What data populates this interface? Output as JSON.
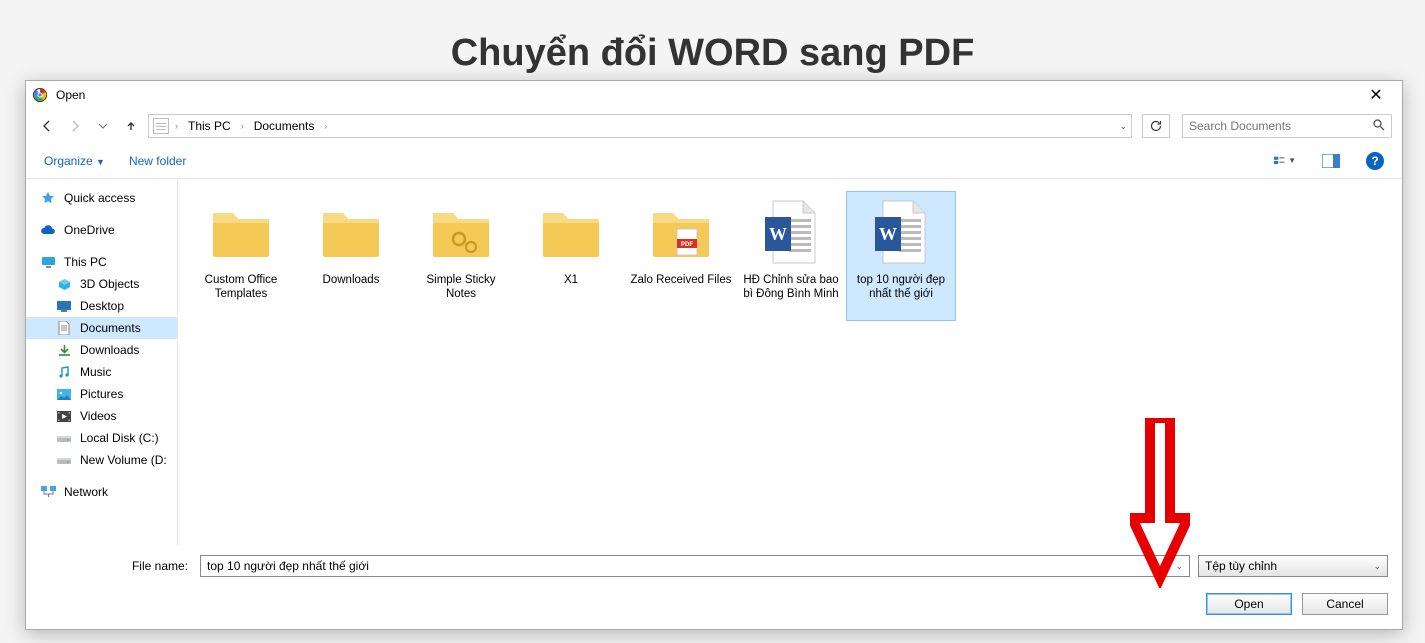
{
  "page": {
    "heading": "Chuyển đổi WORD sang PDF"
  },
  "dialog": {
    "title": "Open",
    "breadcrumb": {
      "root_sep": "›",
      "parts": [
        "This PC",
        "Documents"
      ]
    },
    "search_placeholder": "Search Documents",
    "toolbar": {
      "organize": "Organize",
      "new_folder": "New folder"
    },
    "sidebar": {
      "quick_access": "Quick access",
      "onedrive": "OneDrive",
      "this_pc": "This PC",
      "items": [
        "3D Objects",
        "Desktop",
        "Documents",
        "Downloads",
        "Music",
        "Pictures",
        "Videos",
        "Local Disk (C:)",
        "New Volume (D:"
      ],
      "network": "Network"
    },
    "files": [
      {
        "name": "Custom Office Templates",
        "type": "folder"
      },
      {
        "name": "Downloads",
        "type": "folder"
      },
      {
        "name": "Simple Sticky Notes",
        "type": "folder-gears"
      },
      {
        "name": "X1",
        "type": "folder"
      },
      {
        "name": "Zalo Received Files",
        "type": "folder-pdf"
      },
      {
        "name": "HĐ Chỉnh sửa bao bì Đông Bình Minh",
        "type": "word"
      },
      {
        "name": "top 10 người đẹp nhất thế giới",
        "type": "word",
        "selected": true
      }
    ],
    "footer": {
      "filename_label": "File name:",
      "filename_value": "top 10 người đẹp nhất thế giới",
      "filetype_label": "Tệp tùy chỉnh",
      "open": "Open",
      "cancel": "Cancel"
    }
  }
}
